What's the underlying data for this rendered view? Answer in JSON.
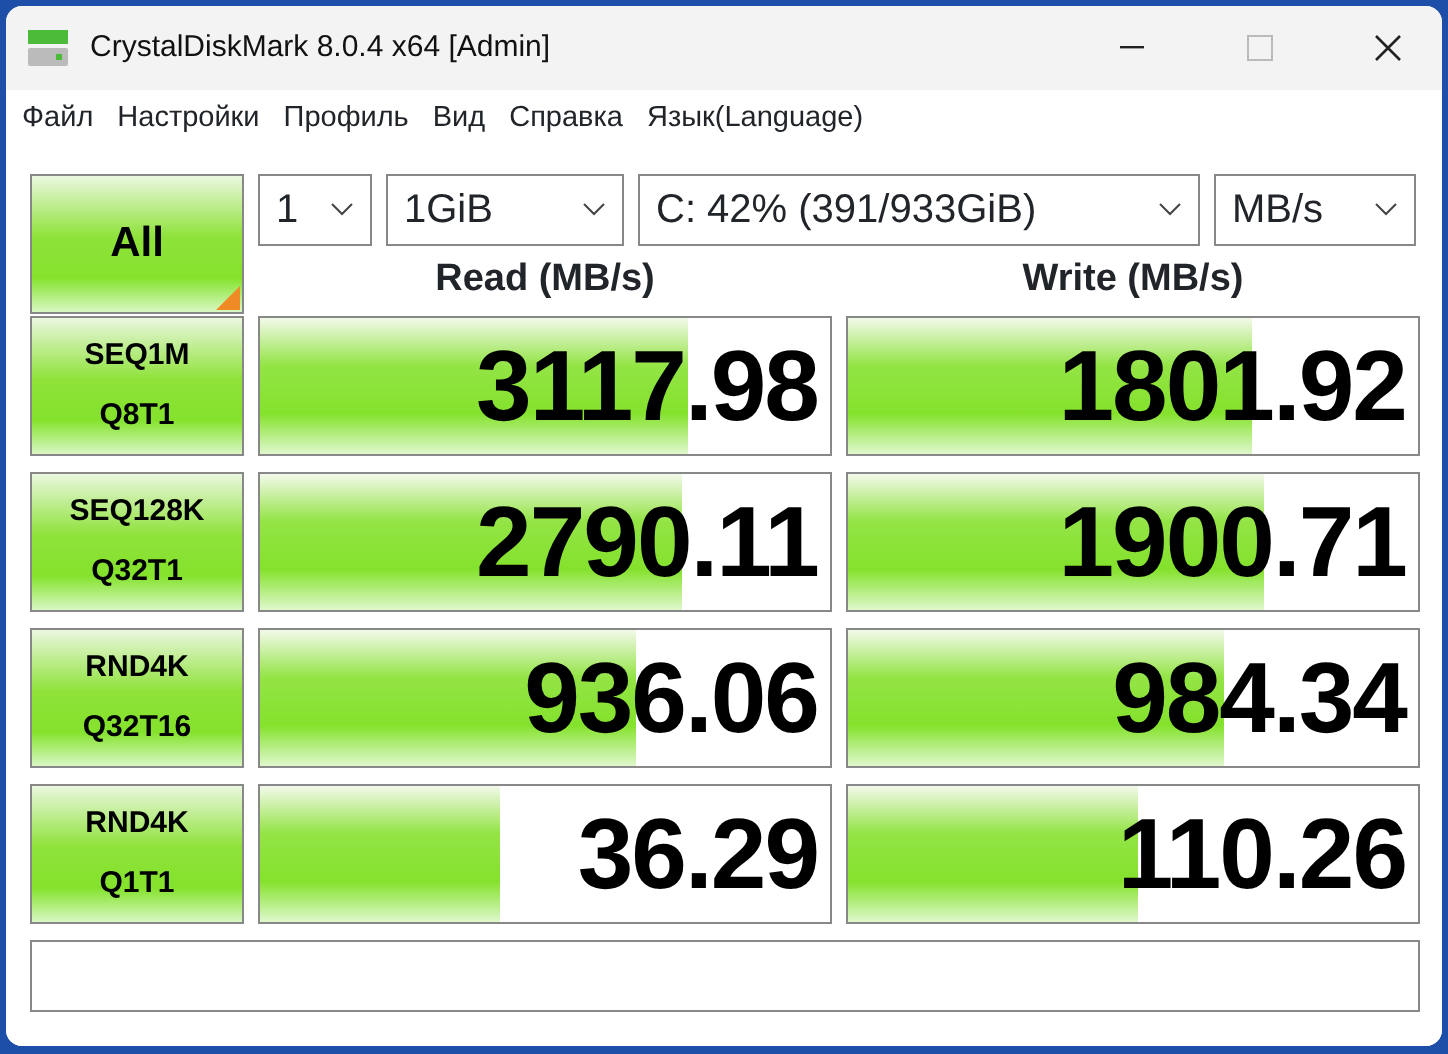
{
  "window": {
    "title": "CrystalDiskMark 8.0.4 x64 [Admin]"
  },
  "menu": [
    "Файл",
    "Настройки",
    "Профиль",
    "Вид",
    "Справка",
    "Язык(Language)"
  ],
  "controls": {
    "all_button": "All",
    "count": "1",
    "size": "1GiB",
    "drive": "C: 42% (391/933GiB)",
    "unit": "MB/s"
  },
  "headers": {
    "read": "Read (MB/s)",
    "write": "Write (MB/s)"
  },
  "rows": [
    {
      "test": [
        "SEQ1M",
        "Q8T1"
      ],
      "read": {
        "value": "3117.98",
        "level": 0.75
      },
      "write": {
        "value": "1801.92",
        "level": 0.71
      }
    },
    {
      "test": [
        "SEQ128K",
        "Q32T1"
      ],
      "read": {
        "value": "2790.11",
        "level": 0.74
      },
      "write": {
        "value": "1900.71",
        "level": 0.73
      }
    },
    {
      "test": [
        "RND4K",
        "Q32T16"
      ],
      "read": {
        "value": "936.06",
        "level": 0.66
      },
      "write": {
        "value": "984.34",
        "level": 0.66
      }
    },
    {
      "test": [
        "RND4K",
        "Q1T1"
      ],
      "read": {
        "value": "36.29",
        "level": 0.42
      },
      "write": {
        "value": "110.26",
        "level": 0.51
      }
    }
  ]
}
